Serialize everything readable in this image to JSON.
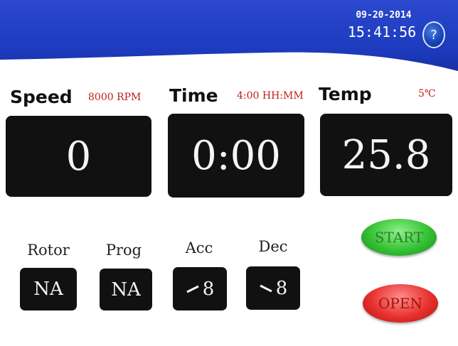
{
  "header": {
    "date": "09-20-2014",
    "time": "15:41:56",
    "help_label": "?"
  },
  "speed": {
    "label": "Speed",
    "setpoint": "8000 RPM",
    "current": "0"
  },
  "time": {
    "label": "Time",
    "setpoint": "4:00 HH:MM",
    "current": "0:00"
  },
  "temp": {
    "label": "Temp",
    "setpoint": "5℃",
    "current": "25.8"
  },
  "rotor": {
    "label": "Rotor",
    "value": "NA"
  },
  "prog": {
    "label": "Prog",
    "value": "NA"
  },
  "acc": {
    "label": "Acc",
    "value": "8",
    "icon": "accel-ramp-icon"
  },
  "dec": {
    "label": "Dec",
    "value": "8",
    "icon": "decel-ramp-icon"
  },
  "buttons": {
    "start_label": "START",
    "open_label": "OPEN"
  },
  "colors": {
    "header_blue": "#1f3fc4",
    "setpoint_red": "#c0201a",
    "start_green": "#35c234",
    "open_red": "#e8312f",
    "display_bg": "#111111"
  }
}
